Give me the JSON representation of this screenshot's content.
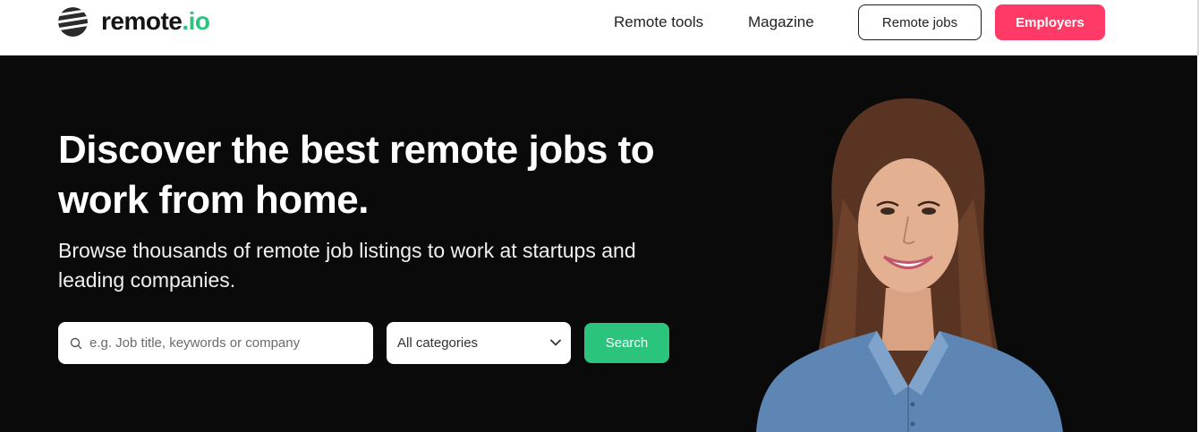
{
  "header": {
    "logo": {
      "name": "remote",
      "tld": ".io"
    },
    "nav": [
      {
        "label": "Remote tools"
      },
      {
        "label": "Magazine"
      }
    ],
    "remote_jobs_label": "Remote jobs",
    "employers_label": "Employers"
  },
  "hero": {
    "title": "Discover the best remote jobs to work from home.",
    "subtitle": "Browse thousands of remote job listings to work at startups and leading companies.",
    "search": {
      "placeholder": "e.g. Job title, keywords or company",
      "value": ""
    },
    "category": {
      "selected": "All categories"
    },
    "search_button_label": "Search",
    "photo": "smiling-woman-denim-shirt"
  },
  "colors": {
    "accent_green": "#2bc47d",
    "accent_pink": "#ff3a66",
    "hero_background": "#0a0a0a"
  },
  "icons": {
    "logo": "remote-logo-icon",
    "search": "search-icon",
    "dropdown": "chevron-down-icon"
  }
}
